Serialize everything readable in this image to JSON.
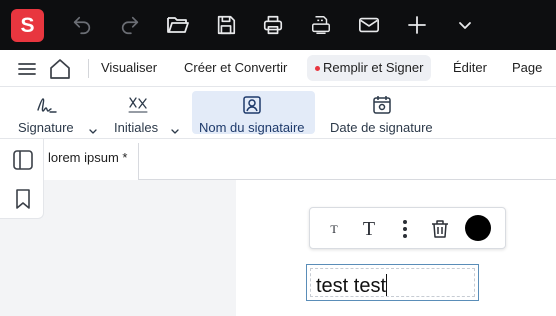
{
  "app": {
    "logo_letter": "S",
    "brand_color": "#e8363f"
  },
  "toolbar": {
    "icons": [
      "undo-icon",
      "redo-icon",
      "open-folder-icon",
      "save-icon",
      "print-icon",
      "scan-icon",
      "mail-icon",
      "plus-icon",
      "chevron-down-icon"
    ]
  },
  "menu": {
    "items": [
      {
        "label": "Visualiser"
      },
      {
        "label": "Créer et Convertir"
      },
      {
        "label": "Remplir et Signer"
      },
      {
        "label": "Éditer"
      },
      {
        "label": "Page"
      }
    ],
    "active_index": 2
  },
  "ribbon": {
    "tools": [
      {
        "label": "Signature",
        "icon": "signature-icon",
        "dropdown": true
      },
      {
        "label": "Initiales",
        "icon": "initials-icon",
        "dropdown": true
      },
      {
        "label": "Nom du signataire",
        "icon": "signer-name-icon",
        "dropdown": false,
        "selected": true
      },
      {
        "label": "Date de signature",
        "icon": "calendar-icon",
        "dropdown": false
      }
    ]
  },
  "document": {
    "tab_label": "lorem ipsum *"
  },
  "text_field": {
    "value": "test test"
  },
  "format_toolbar": {
    "small_text_glyph": "T",
    "large_text_glyph": "T",
    "color": "#000000"
  }
}
